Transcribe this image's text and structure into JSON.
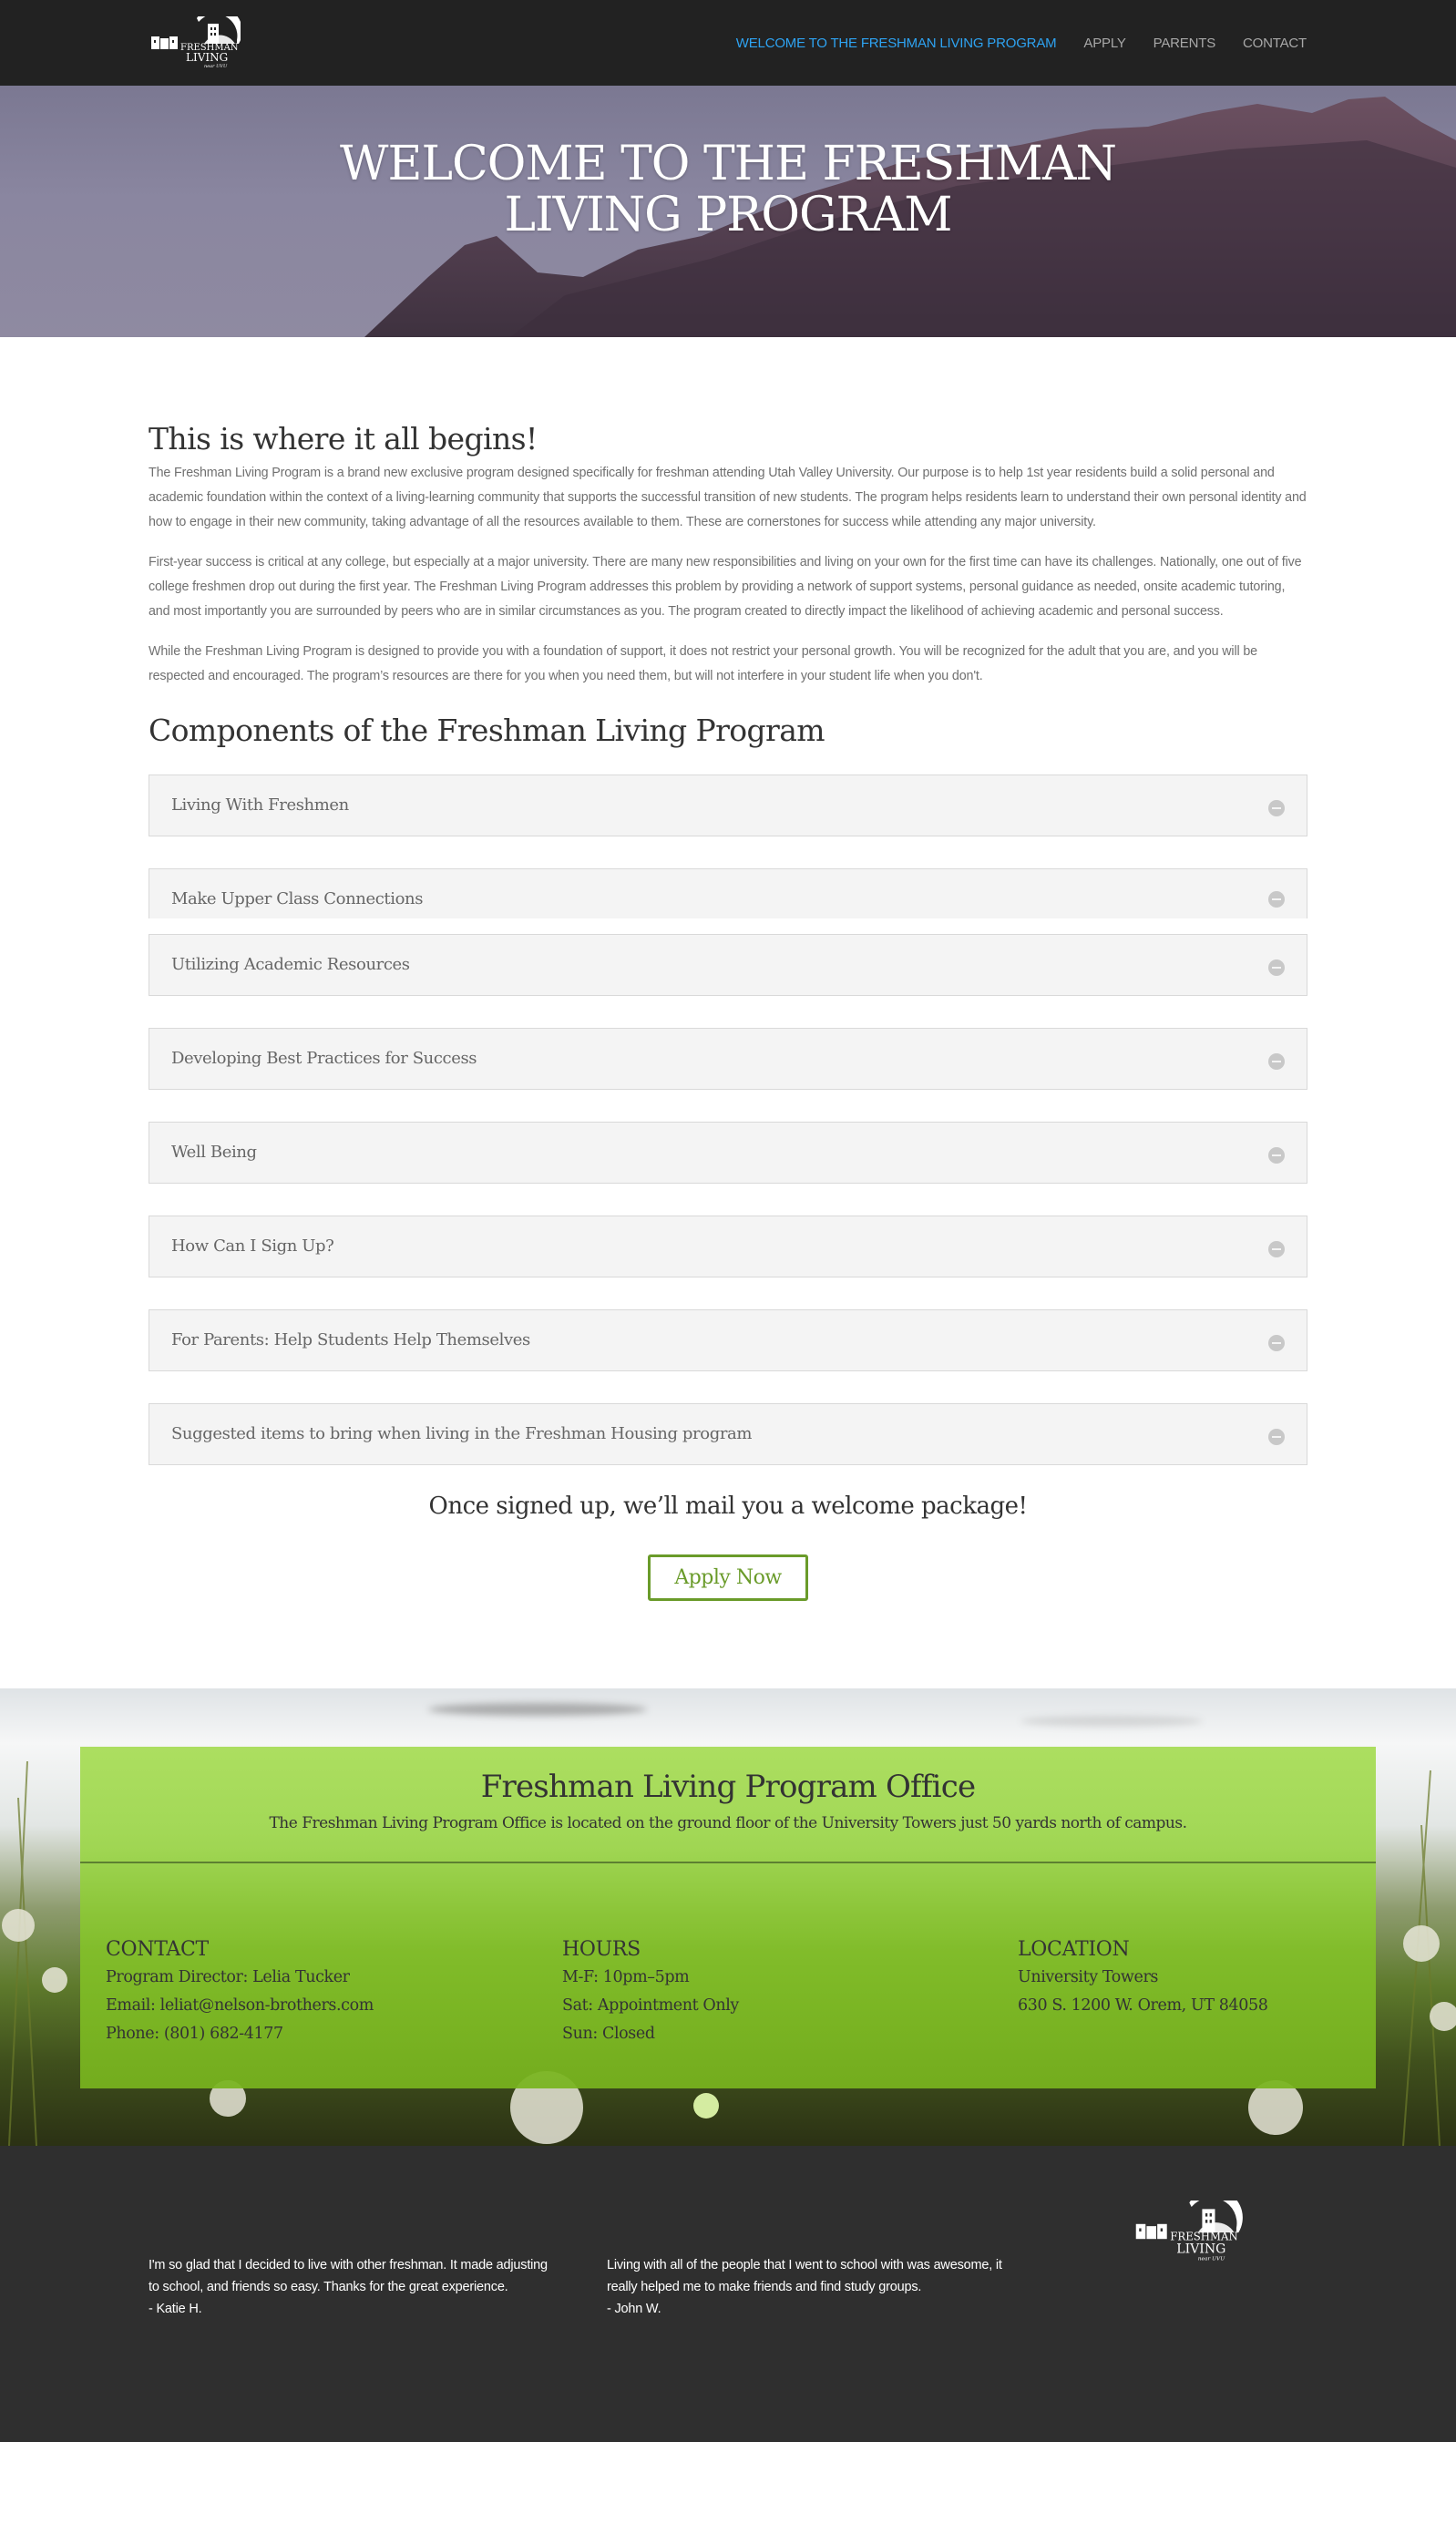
{
  "header": {
    "logo_alt": "Freshman Living near UVU",
    "nav": [
      {
        "label": "WELCOME TO THE FRESHMAN LIVING PROGRAM",
        "active": true
      },
      {
        "label": "APPLY",
        "active": false
      },
      {
        "label": "PARENTS",
        "active": false
      },
      {
        "label": "CONTACT",
        "active": false
      }
    ],
    "accent_color": "#2ea3f2"
  },
  "hero": {
    "title": "WELCOME TO THE FRESHMAN LIVING PROGRAM"
  },
  "intro": {
    "title": "This is where it all begins!",
    "paragraphs": [
      "The Freshman Living Program is a brand new exclusive program designed specifically for freshman attending Utah Valley University. Our purpose is to help 1st year residents build a solid personal and academic foundation within the context of a living-learning community that supports the successful transition of new students. The program helps residents learn to understand their own personal identity and how to engage in their new community, taking advantage of all the resources available to them.  These are cornerstones for success while attending any major university.",
      "First-year success is critical at any college, but especially at a major university.  There are many new responsibilities and living on your own for the first time can have its challenges. Nationally, one out of five college freshmen drop out during the first year. The Freshman Living Program addresses this problem by providing a network of support systems, personal guidance as needed, onsite academic tutoring, and most importantly you are surrounded by peers who are in similar circumstances as you.  The program created to directly impact the likelihood of achieving academic and personal success.",
      "While the Freshman Living Program is designed to provide you with a foundation of support, it does not restrict your personal growth. You will be recognized for the adult that you are, and you will be respected and encouraged. The program’s resources are there for you when you need them, but will not interfere in your student life when you don't."
    ]
  },
  "components": {
    "title": "Components of the Freshman Living Program",
    "items": [
      {
        "label": "Living With Freshmen",
        "icon": "circle-minus-icon"
      },
      {
        "label": "Make Upper Class Connections",
        "icon": "circle-minus-icon"
      },
      {
        "label": "Utilizing Academic Resources",
        "icon": "circle-minus-icon"
      },
      {
        "label": "Developing Best Practices for Success",
        "icon": "circle-minus-icon"
      },
      {
        "label": "Well Being",
        "icon": "circle-minus-icon"
      },
      {
        "label": "How Can I Sign Up?",
        "icon": "circle-minus-icon"
      },
      {
        "label": "For Parents: Help Students Help Themselves",
        "icon": "circle-minus-icon"
      },
      {
        "label": "Suggested items to bring when living in the Freshman Housing program",
        "icon": "circle-minus-icon"
      }
    ]
  },
  "cta": {
    "note": "Once signed up, we’ll mail you a welcome package!",
    "button_label": "Apply Now",
    "button_color": "#6a9b2a"
  },
  "office": {
    "title": "Freshman Living Program Office",
    "description": "The Freshman Living Program Office is located on the ground floor of the University Towers just 50 yards north of campus.",
    "contact": {
      "heading": "CONTACT",
      "lines": [
        "Program Director: Lelia Tucker",
        "Email: leliat@nelson-brothers.com",
        "Phone: (801) 682-4177"
      ]
    },
    "hours": {
      "heading": "HOURS",
      "lines": [
        "M-F: 10pm–5pm",
        "Sat: Appointment Only",
        "Sun: Closed"
      ]
    },
    "location": {
      "heading": "LOCATION",
      "lines": [
        "University Towers",
        "630 S. 1200 W. Orem, UT 84058"
      ]
    },
    "box_color": "#9cd64a"
  },
  "footer": {
    "testimonials": [
      {
        "quote": "I'm so glad that I decided to live with other freshman. It made adjusting to school, and friends so easy. Thanks for the great experience.",
        "author": "- Katie H."
      },
      {
        "quote": "Living with all of the people that I went to school with was awesome, it really helped me to make friends and find study groups.",
        "author": "- John W."
      }
    ],
    "logo_alt": "Freshman Living near UVU"
  }
}
